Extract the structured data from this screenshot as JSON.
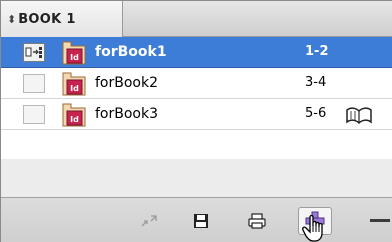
{
  "panel": {
    "tab": {
      "arrows": "⬍",
      "label": "BOOK 1"
    }
  },
  "documents": [
    {
      "name": "forBook1",
      "pages": "1-2",
      "selected": true,
      "status_icon": "sync-source-icon",
      "extra_icon": ""
    },
    {
      "name": "forBook2",
      "pages": "3-4",
      "selected": false,
      "status_icon": "",
      "extra_icon": ""
    },
    {
      "name": "forBook3",
      "pages": "5-6",
      "selected": false,
      "status_icon": "",
      "extra_icon": "open-book-icon"
    }
  ],
  "doc_icon_label": "Id",
  "toolbar": {
    "buttons": [
      "synchronize-icon",
      "save-icon",
      "print-icon",
      "add-document-icon",
      "remove-document-icon"
    ]
  },
  "colors": {
    "selection": "#3d7dd8",
    "indesign_icon": "#c8234f"
  }
}
